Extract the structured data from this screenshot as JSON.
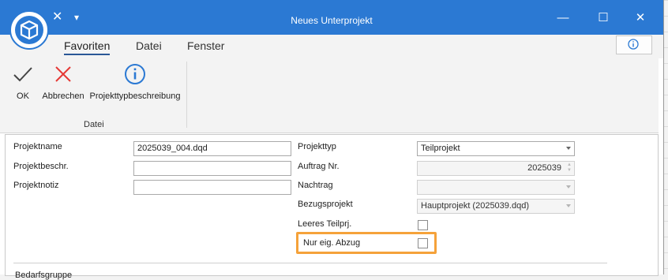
{
  "window": {
    "title": "Neues Unterprojekt"
  },
  "titlebar": {
    "minimize": "—",
    "maximize": "☐",
    "close": "✕",
    "quick_close": "✕",
    "quick_dropdown": "▾"
  },
  "tabs": [
    {
      "label": "Favoriten",
      "active": true
    },
    {
      "label": "Datei"
    },
    {
      "label": "Fenster"
    }
  ],
  "ribbon": {
    "buttons": [
      {
        "label": "OK",
        "icon": "checkmark-icon"
      },
      {
        "label": "Abbrechen",
        "icon": "cancel-x-icon"
      },
      {
        "label": "Projekttypbeschreibung",
        "icon": "info-icon"
      }
    ],
    "group_label": "Datei"
  },
  "form": {
    "projektname": {
      "label": "Projektname",
      "value": "2025039_004.dqd"
    },
    "projektbeschr": {
      "label": "Projektbeschr.",
      "value": ""
    },
    "projektnotiz": {
      "label": "Projektnotiz",
      "value": ""
    },
    "projekttyp": {
      "label": "Projekttyp",
      "value": "Teilprojekt"
    },
    "auftrag_nr": {
      "label": "Auftrag Nr.",
      "value": "2025039"
    },
    "nachtrag": {
      "label": "Nachtrag",
      "value": ""
    },
    "bezugsprojekt": {
      "label": "Bezugsprojekt",
      "value": "Hauptprojekt (2025039.dqd)"
    },
    "leeres_teilprj": {
      "label": "Leeres Teilprj.",
      "checked": false
    },
    "nur_eig_abzug": {
      "label": "Nur eig. Abzug",
      "checked": false
    },
    "cut_section_label": "Bedarfsgruppe"
  },
  "colors": {
    "titlebar": "#2b79d3",
    "highlight": "#f5a23a",
    "cancel": "#e53935",
    "info": "#2b79d3"
  }
}
